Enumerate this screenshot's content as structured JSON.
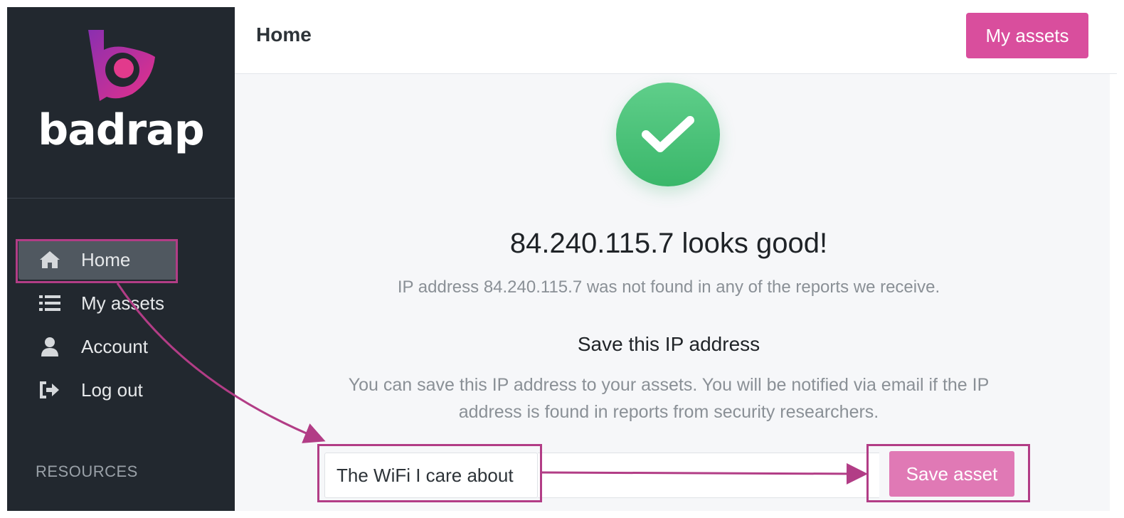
{
  "brand": {
    "name": "badrap",
    "logo_icon": "badrap-logo-icon"
  },
  "sidebar": {
    "items": [
      {
        "label": "Home",
        "icon": "home-icon",
        "active": true
      },
      {
        "label": "My assets",
        "icon": "list-icon"
      },
      {
        "label": "Account",
        "icon": "user-icon"
      },
      {
        "label": "Log out",
        "icon": "logout-icon"
      }
    ],
    "section_label": "RESOURCES"
  },
  "header": {
    "title": "Home",
    "button_label": "My assets"
  },
  "main": {
    "status_icon": "check-circle-icon",
    "headline": "84.240.115.7 looks good!",
    "subline": "IP address 84.240.115.7 was not found in any of the reports we receive.",
    "save_title": "Save this IP address",
    "save_description": "You can save this IP address to your assets. You will be notified via email if the IP address is found in reports from security researchers.",
    "asset_name_value": "The WiFi I care about",
    "save_button_label": "Save asset"
  },
  "colors": {
    "sidebar_bg": "#22282f",
    "accent": "#d94e9d",
    "success": "#45be73",
    "annotation": "#b23d86"
  }
}
